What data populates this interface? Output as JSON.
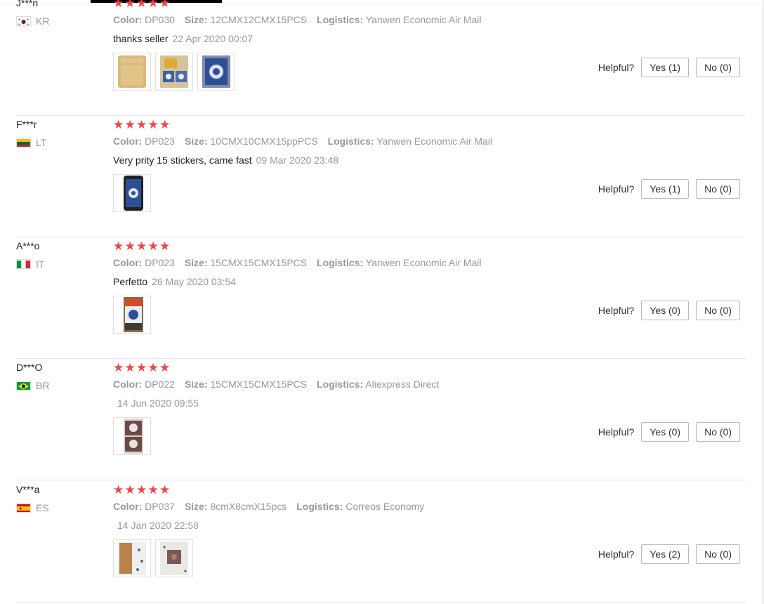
{
  "reviews": [
    {
      "user": "J***n",
      "country": "KR",
      "flag": "kr",
      "stars": 5,
      "color_label": "Color:",
      "color": "DP030",
      "size_label": "Size:",
      "size": "12CMX12CMX15PCS",
      "logistics_label": "Logistics:",
      "logistics": "Yanwen Economic Air Mail",
      "comment": "thanks seller",
      "date": "22 Apr 2020 00:07",
      "photos": [
        "kraft-envelope-photo",
        "tiles-on-envelope-photo",
        "blue-tile-sticker-photo"
      ],
      "helpful_label": "Helpful?",
      "yes": "Yes (1)",
      "no": "No (0)"
    },
    {
      "user": "F***r",
      "country": "LT",
      "flag": "lt",
      "stars": 5,
      "color_label": "Color:",
      "color": "DP023",
      "size_label": "Size:",
      "size": "10CMX10CMX15ppPCS",
      "logistics_label": "Logistics:",
      "logistics": "Yanwen Economic Air Mail",
      "comment": "Very prity 15 stickers, came fast",
      "date": "09 Mar 2020 23:48",
      "photos": [
        "phone-with-sticker-photo"
      ],
      "helpful_label": "Helpful?",
      "yes": "Yes (1)",
      "no": "No (0)"
    },
    {
      "user": "A***o",
      "country": "IT",
      "flag": "it",
      "stars": 5,
      "color_label": "Color:",
      "color": "DP023",
      "size_label": "Size:",
      "size": "15CMX15CMX15PCS",
      "logistics_label": "Logistics:",
      "logistics": "Yanwen Economic Air Mail",
      "comment": "Perfetto",
      "date": "26 May 2020 03:54",
      "photos": [
        "sticker-on-tile-photo"
      ],
      "helpful_label": "Helpful?",
      "yes": "Yes (0)",
      "no": "No (0)"
    },
    {
      "user": "D***O",
      "country": "BR",
      "flag": "br",
      "stars": 5,
      "color_label": "Color:",
      "color": "DP022",
      "size_label": "Size:",
      "size": "15CMX15CMX15PCS",
      "logistics_label": "Logistics:",
      "logistics": "Aliexpress Direct",
      "comment": "",
      "date": "14 Jun 2020 09:55",
      "photos": [
        "dark-tile-pattern-photo"
      ],
      "helpful_label": "Helpful?",
      "yes": "Yes (0)",
      "no": "No (0)"
    },
    {
      "user": "V***a",
      "country": "ES",
      "flag": "es",
      "stars": 5,
      "color_label": "Color:",
      "color": "DP037",
      "size_label": "Size:",
      "size": "8cmX8cmX15pcs",
      "logistics_label": "Logistics:",
      "logistics": "Correos Economy",
      "comment": "",
      "date": "14 Jan 2020 22:58",
      "photos": [
        "packaged-stickers-photo",
        "single-sticker-photo"
      ],
      "helpful_label": "Helpful?",
      "yes": "Yes (2)",
      "no": "No (0)"
    }
  ]
}
